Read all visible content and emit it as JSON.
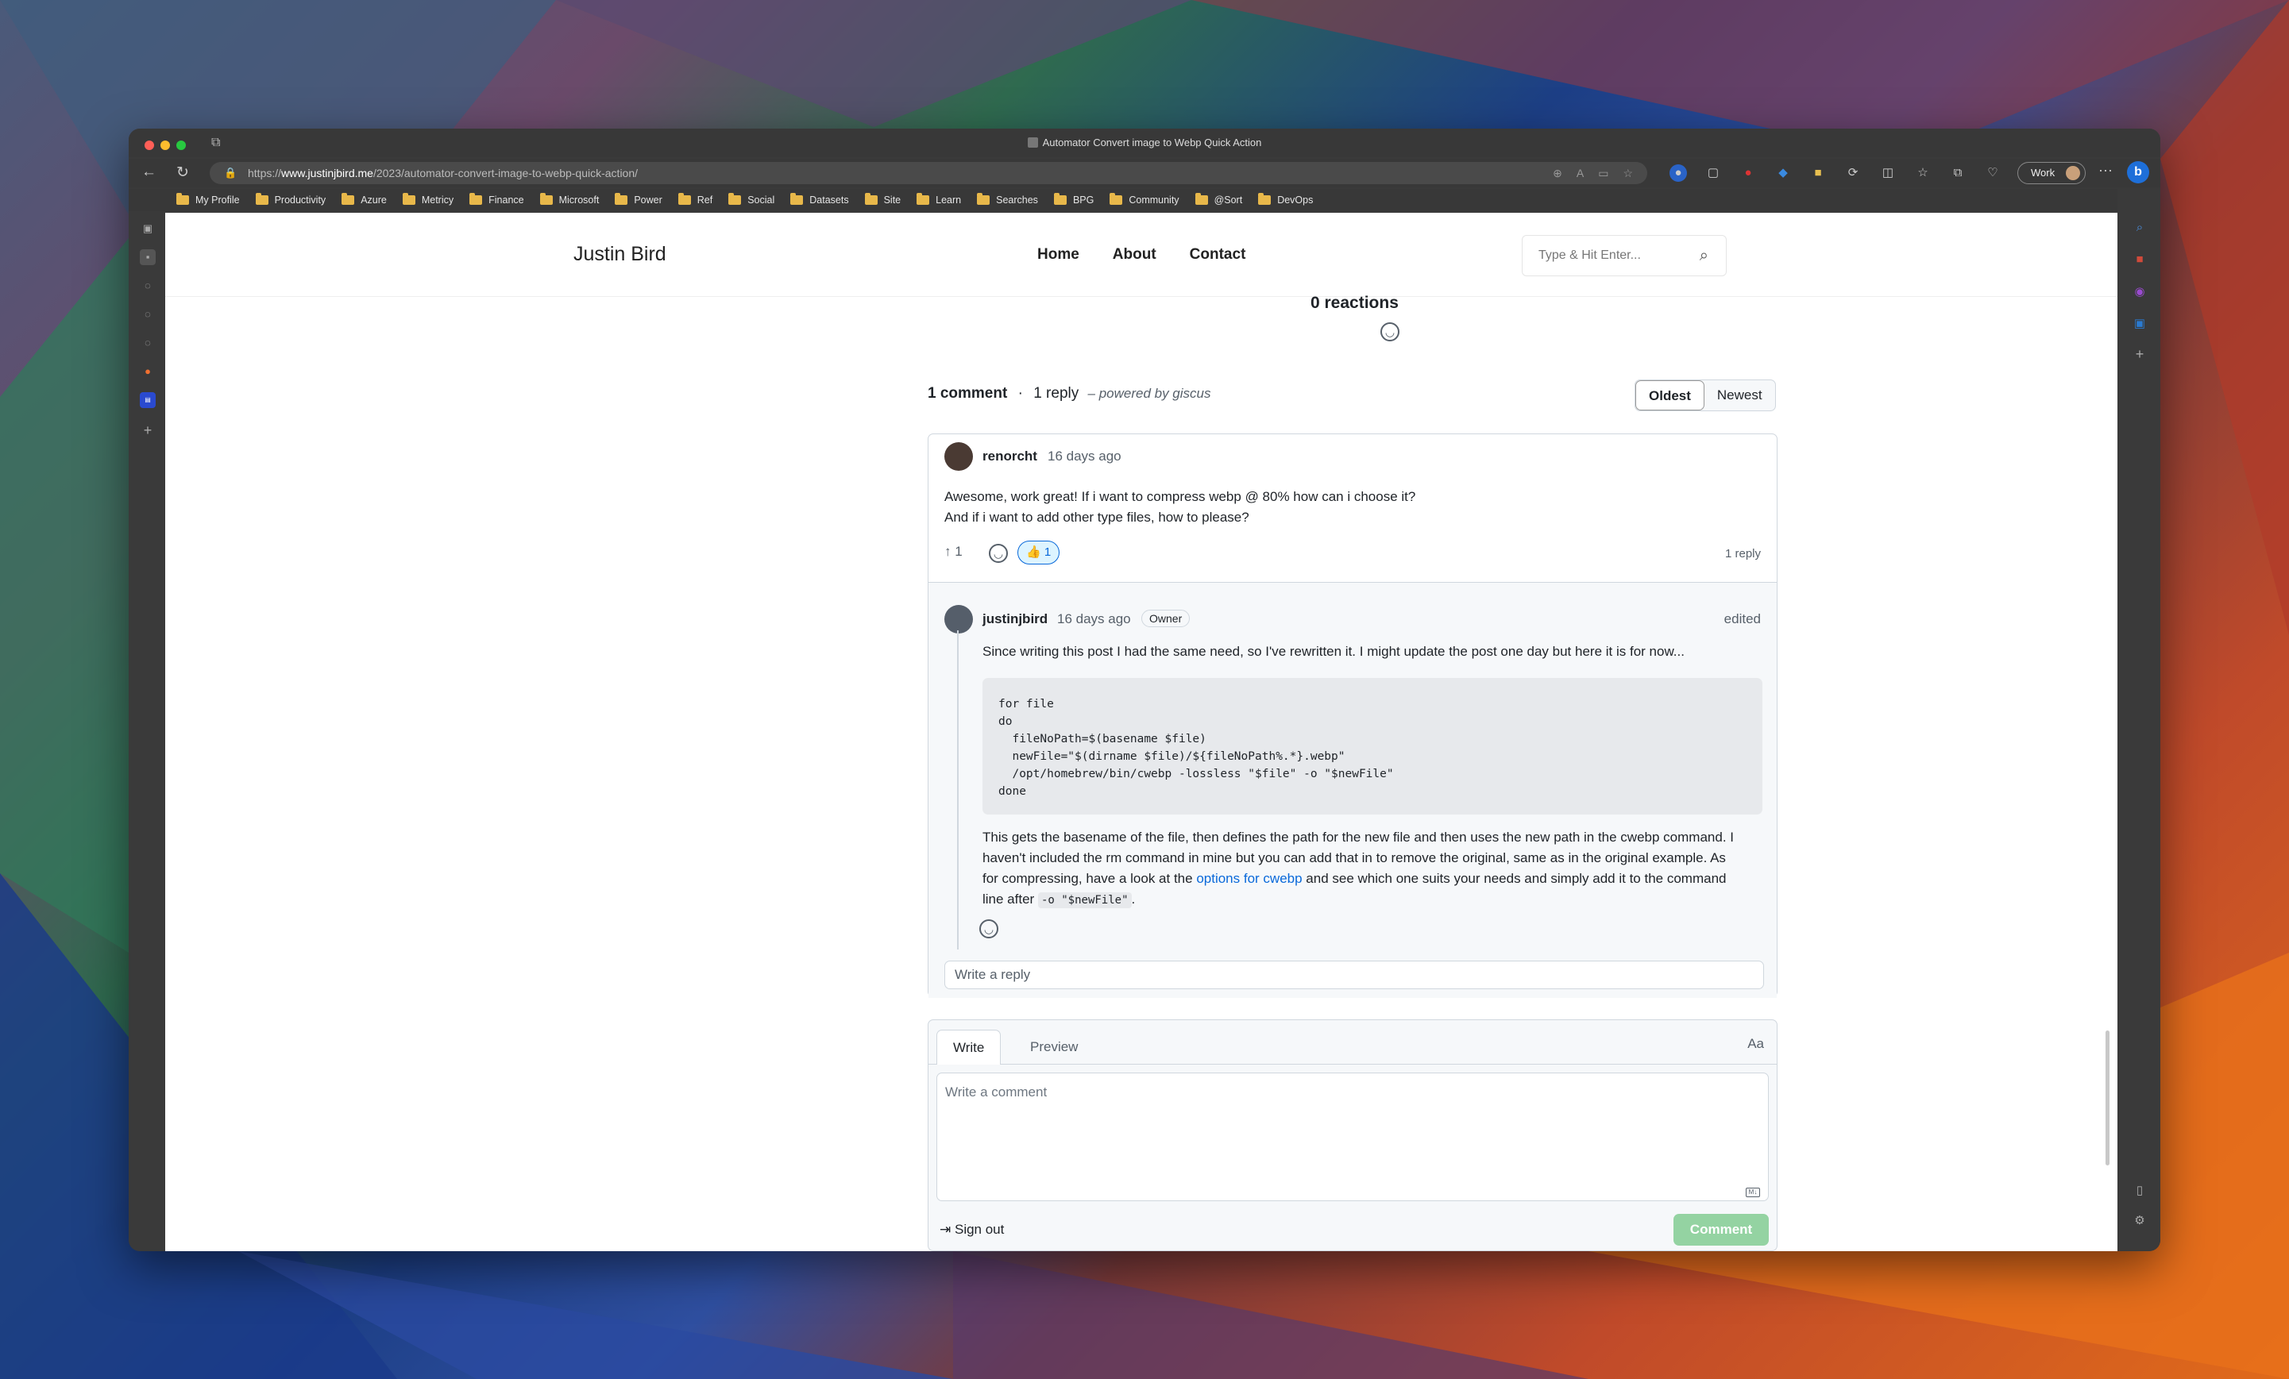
{
  "window": {
    "title": "Automator Convert image to Webp Quick Action"
  },
  "browser": {
    "url_prefix": "https://",
    "url_domain": "www.justinjbird.me",
    "url_path": "/2023/automator-convert-image-to-webp-quick-action/",
    "profile_label": "Work",
    "bookmarks": [
      "My Profile",
      "Productivity",
      "Azure",
      "Metricy",
      "Finance",
      "Microsoft",
      "Power",
      "Ref",
      "Social",
      "Datasets",
      "Site",
      "Learn",
      "Searches",
      "BPG",
      "Community",
      "@Sort",
      "DevOps"
    ]
  },
  "site": {
    "brand": "Justin Bird",
    "nav": [
      "Home",
      "About",
      "Contact"
    ],
    "search_placeholder": "Type & Hit Enter..."
  },
  "giscus": {
    "reactions_label": "0 reactions",
    "comment_count": "1 comment",
    "separator": "·",
    "reply_count": "1 reply",
    "powered": "– powered by giscus",
    "sort_oldest": "Oldest",
    "sort_newest": "Newest",
    "comment": {
      "author": "renorcht",
      "time": "16 days ago",
      "body_line1": "Awesome, work great! If i want to compress webp @ 80% how can i choose it?",
      "body_line2": "And if i want to add other type files, how to please?",
      "upvotes": "1",
      "thumbs": "👍 1",
      "replies_label": "1 reply"
    },
    "reply": {
      "author": "justinjbird",
      "time": "16 days ago",
      "badge": "Owner",
      "edited": "edited",
      "intro": "Since writing this post I had the same need, so I've rewritten it. I might update the post one day but here it is for now...",
      "code": "for file\ndo\n  fileNoPath=$(basename $file)\n  newFile=\"$(dirname $file)/${fileNoPath%.*}.webp\"\n  /opt/homebrew/bin/cwebp -lossless \"$file\" -o \"$newFile\"\ndone",
      "outro_1": "This gets the basename of the file, then defines the path for the new file and then uses the new path in the cwebp command. I haven't included the rm command in mine but you can add that in to remove the original, same as in the original example. As for compressing, have a look at the ",
      "outro_link": "options for cwebp",
      "outro_2": " and see which one suits your needs and simply add it to the command line after ",
      "outro_code": "-o \"$newFile\"",
      "outro_3": "."
    },
    "reply_placeholder": "Write a reply",
    "editor": {
      "tab_write": "Write",
      "tab_preview": "Preview",
      "aa": "Aa",
      "placeholder": "Write a comment",
      "signout": "Sign out",
      "submit": "Comment"
    }
  }
}
